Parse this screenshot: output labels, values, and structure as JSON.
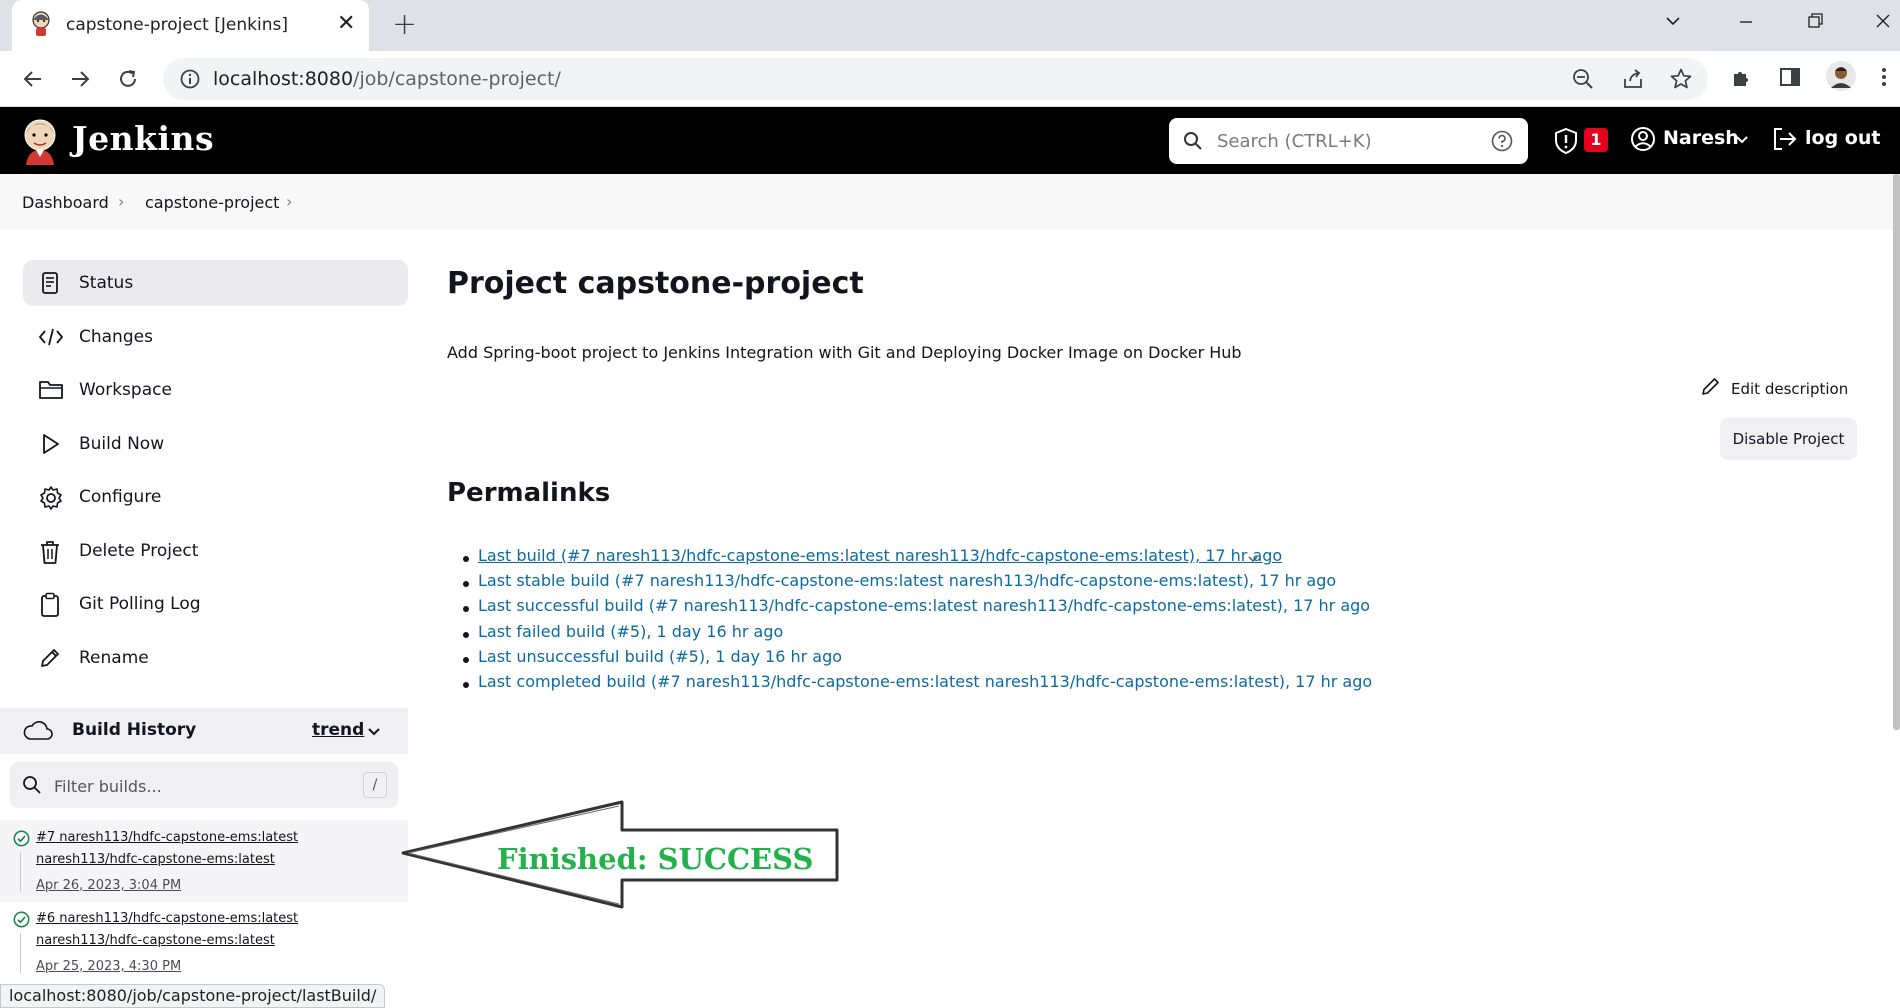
{
  "browser": {
    "tab_title": "capstone-project [Jenkins]",
    "url_host": "localhost:8080",
    "url_path": "/job/capstone-project/",
    "status_url": "localhost:8080/job/capstone-project/lastBuild/"
  },
  "header": {
    "title": "Jenkins",
    "search_placeholder": "Search (CTRL+K)",
    "alert_count": "1",
    "user": "Naresh",
    "logout": "log out"
  },
  "breadcrumb": [
    "Dashboard",
    "capstone-project"
  ],
  "side_tasks": [
    {
      "label": "Status",
      "icon": "status-icon"
    },
    {
      "label": "Changes",
      "icon": "code-icon"
    },
    {
      "label": "Workspace",
      "icon": "folder-icon"
    },
    {
      "label": "Build Now",
      "icon": "play-icon"
    },
    {
      "label": "Configure",
      "icon": "gear-icon"
    },
    {
      "label": "Delete Project",
      "icon": "trash-icon"
    },
    {
      "label": "Git Polling Log",
      "icon": "clipboard-icon"
    },
    {
      "label": "Rename",
      "icon": "pencil-icon"
    }
  ],
  "build_history": {
    "title": "Build History",
    "trend": "trend",
    "filter_placeholder": "Filter builds...",
    "filter_shortcut": "/",
    "builds": [
      {
        "name": "#7 naresh113/hdfc-capstone-ems:latest naresh113/hdfc-capstone-ems:latest",
        "date": "Apr 26, 2023, 3:04 PM",
        "status": "success"
      },
      {
        "name": "#6 naresh113/hdfc-capstone-ems:latest naresh113/hdfc-capstone-ems:latest",
        "date": "Apr 25, 2023, 4:30 PM",
        "status": "success"
      }
    ]
  },
  "main": {
    "title": "Project capstone-project",
    "description": "Add Spring-boot project to Jenkins Integration with Git and Deploying Docker Image on Docker Hub",
    "edit_description": "Edit description",
    "disable_project": "Disable Project",
    "permalinks_heading": "Permalinks",
    "permalinks": [
      "Last build (#7 naresh113/hdfc-capstone-ems:latest naresh113/hdfc-capstone-ems:latest), 17 hr ago",
      "Last stable build (#7 naresh113/hdfc-capstone-ems:latest naresh113/hdfc-capstone-ems:latest), 17 hr ago",
      "Last successful build (#7 naresh113/hdfc-capstone-ems:latest naresh113/hdfc-capstone-ems:latest), 17 hr ago",
      "Last failed build (#5), 1 day 16 hr ago",
      "Last unsuccessful build (#5), 1 day 16 hr ago",
      "Last completed build (#7 naresh113/hdfc-capstone-ems:latest naresh113/hdfc-capstone-ems:latest), 17 hr ago"
    ]
  },
  "annotation": {
    "text": "Finished: SUCCESS",
    "color": "#22b14c"
  },
  "colors": {
    "link": "#0b6aa2",
    "header_bg": "#000000",
    "success": "#138347",
    "badge": "#e6001f"
  }
}
